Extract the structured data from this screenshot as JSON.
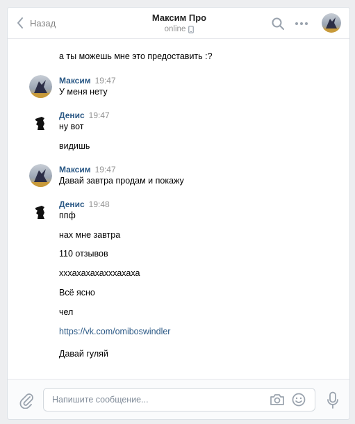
{
  "header": {
    "back_label": "Назад",
    "title": "Максим Про",
    "status": "online"
  },
  "messages": [
    {
      "text": "а ты можешь мне это предоставить :?"
    },
    {
      "author": "Максим",
      "time": "19:47",
      "text": "У меня нету"
    },
    {
      "author": "Денис",
      "time": "19:47",
      "text": "ну вот"
    },
    {
      "text": "видишь"
    },
    {
      "author": "Максим",
      "time": "19:47",
      "text": "Давай завтра продам и покажу"
    },
    {
      "author": "Денис",
      "time": "19:48",
      "text": "ппф"
    },
    {
      "text": "нах мне завтра"
    },
    {
      "text": "110 отзывов"
    },
    {
      "text": "хххахахахахххахаха"
    },
    {
      "text": "Всё ясно"
    },
    {
      "text": "чел"
    },
    {
      "text": "https://vk.com/omiboswindler"
    },
    {
      "text": "Давай гуляй"
    }
  ],
  "composer": {
    "placeholder": "Напишите сообщение..."
  },
  "colors": {
    "accent": "#2a5885",
    "muted": "#939393",
    "icon": "#99a2ad",
    "background": "#edeef0"
  }
}
